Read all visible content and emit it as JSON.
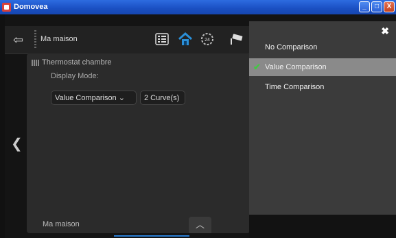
{
  "window": {
    "title": "Domovea",
    "min_label": "_",
    "max_label": "□",
    "close_label": "X"
  },
  "topbar": {
    "home_label": "Ma maison"
  },
  "panel": {
    "device_name": "Thermostat chambre",
    "display_mode_label": "Display Mode:",
    "mode_value": "Value Comparison",
    "curves_label": "2 Curve(s)",
    "footer_label": "Ma maison"
  },
  "dropdown": {
    "options": [
      "No Comparison",
      "Value Comparison",
      "Time Comparison"
    ],
    "selected": "Value Comparison"
  },
  "colors": {
    "accent": "#2a7fd6",
    "check": "#43c843",
    "home_icon": "#2a8fd8"
  }
}
